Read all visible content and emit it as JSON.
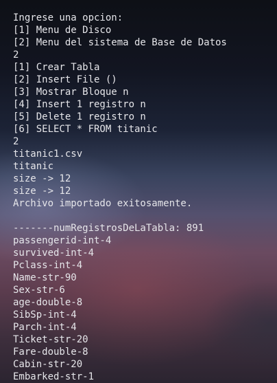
{
  "terminal": {
    "lines": [
      "Ingrese una opcion:",
      "[1] Menu de Disco",
      "[2] Menu del sistema de Base de Datos",
      "2",
      "[1] Crear Tabla",
      "[2] Insert File ()",
      "[3] Mostrar Bloque n",
      "[4] Insert 1 registro n",
      "[5] Delete 1 registro n",
      "[6] SELECT * FROM titanic",
      "2",
      "titanic1.csv",
      "titanic",
      "size -> 12",
      "size -> 12",
      "Archivo importado exitosamente.",
      "",
      "-------numRegistrosDeLaTabla: 891",
      "passengerid-int-4",
      "survived-int-4",
      "Pclass-int-4",
      "Name-str-90",
      "Sex-str-6",
      "age-double-8",
      "SibSp-int-4",
      "Parch-int-4",
      "Ticket-str-20",
      "Fare-double-8",
      "Cabin-str-20",
      "Embarked-str-1"
    ]
  },
  "colors": {
    "text": "#e6e6ea"
  }
}
